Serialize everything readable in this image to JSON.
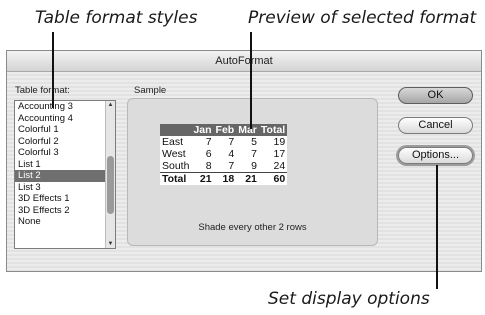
{
  "callouts": {
    "table_format_styles": "Table format styles",
    "preview": "Preview of selected format",
    "display_options": "Set display options"
  },
  "dialog": {
    "title": "AutoFormat",
    "table_format_label": "Table format:",
    "sample_label": "Sample",
    "caption": "Shade every other 2 rows"
  },
  "formats": [
    "Accounting 3",
    "Accounting 4",
    "Colorful 1",
    "Colorful 2",
    "Colorful 3",
    "List 1",
    "List 2",
    "List 3",
    "3D Effects 1",
    "3D Effects 2",
    "None"
  ],
  "selected_format": "List 2",
  "sample_table": {
    "headers": [
      "",
      "Jan",
      "Feb",
      "Mar",
      "Total"
    ],
    "rows": [
      [
        "East",
        "7",
        "7",
        "5",
        "19"
      ],
      [
        "West",
        "6",
        "4",
        "7",
        "17"
      ],
      [
        "South",
        "8",
        "7",
        "9",
        "24"
      ],
      [
        "Total",
        "21",
        "18",
        "21",
        "60"
      ]
    ]
  },
  "buttons": {
    "ok": "OK",
    "cancel": "Cancel",
    "options": "Options..."
  },
  "colors": {
    "selection": "#6f6f6f",
    "table_header": "#666666"
  }
}
